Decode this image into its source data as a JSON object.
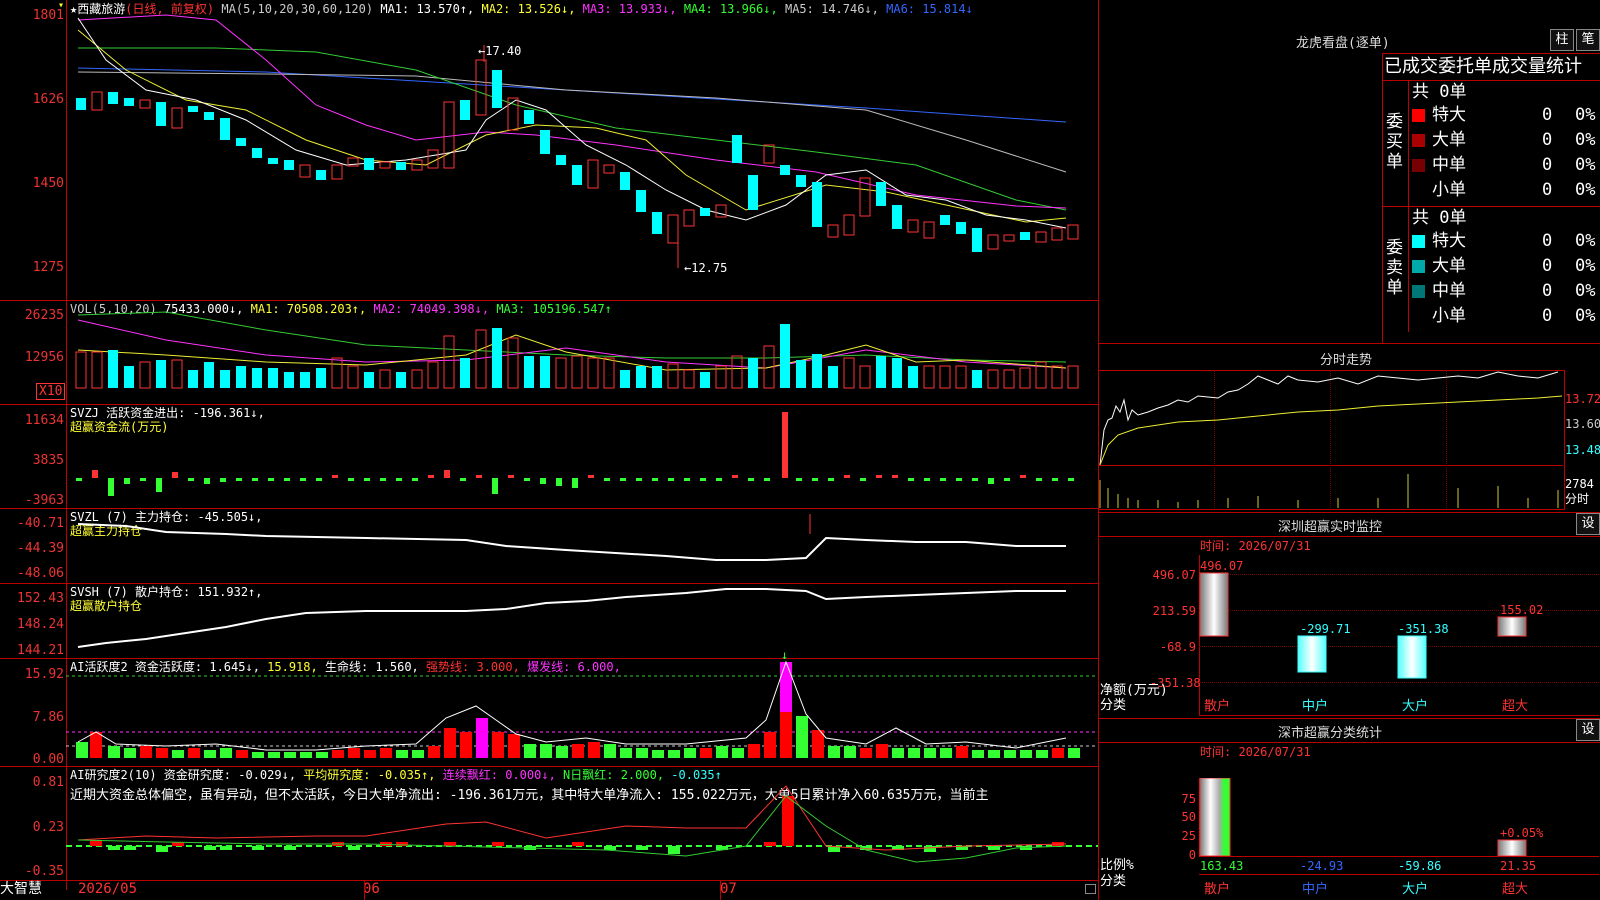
{
  "stock": {
    "name": "西藏旅游",
    "period": "(日线, 前复权)",
    "ma_prefix": "MA(5,10,20,30,60,120)",
    "ma1": "MA1: 13.570↑,",
    "ma2": "MA2: 13.526↓,",
    "ma3": "MA3: 13.933↓,",
    "ma4": "MA4: 13.966↓,",
    "ma5": "MA5: 14.746↓,",
    "ma6": "MA6: 15.814↓",
    "high_mark": "←17.40",
    "low_mark": "←12.75",
    "y_ticks": [
      "1801",
      "1626",
      "1450",
      "1275"
    ]
  },
  "vol": {
    "prefix": "VOL(5,10,20)",
    "value": "75433.000↓,",
    "ma1": "MA1: 70508.203↑,",
    "ma2": "MA2: 74049.398↓,",
    "ma3": "MA3: 105196.547↑",
    "y_ticks": [
      "26235",
      "12956"
    ],
    "unit": "X10"
  },
  "svzj": {
    "title": "SVZJ  活跃资金进出: -196.361↓,",
    "sub": "超赢资金流(万元)",
    "y_ticks": [
      "11634",
      "3835",
      "-3963"
    ]
  },
  "svzl": {
    "title": "SVZL (7) 主力持仓: -45.505↓,",
    "sub": "超赢主力持仓",
    "y_ticks": [
      "-40.71",
      "-44.39",
      "-48.06"
    ]
  },
  "svsh": {
    "title": "SVSH (7) 散户持仓: 151.932↑,",
    "sub": "超赢散户持仓",
    "y_ticks": [
      "152.43",
      "148.24",
      "144.21"
    ]
  },
  "ai2": {
    "title": "AI活跃度2 资金活跃度: 1.645↓,",
    "v2": "15.918,",
    "v3": "生命线: 1.560,",
    "v4": "强势线: 3.000,",
    "v5": "爆发线: 6.000,",
    "y_ticks": [
      "15.92",
      "7.86",
      "0.00"
    ]
  },
  "ai_research": {
    "title": "AI研究度2(10) 资金研究度: -0.029↓,",
    "avg": "平均研究度: -0.035↑,",
    "red1": "连续飘红: 0.000↓,",
    "red2": "N日飘红: 2.000,",
    "red3": "-0.035↑",
    "comment": "近期大资金总体偏空，虽有异动，但不太活跃，今日大单净流出: -196.361万元，其中特大单净流入: 155.022万元，大单5日累计净入60.635万元，当前主",
    "y_ticks": [
      "0.81",
      "0.23",
      "-0.35"
    ]
  },
  "xaxis": {
    "labels": [
      "2026/05",
      "06",
      "07"
    ],
    "logo": "大智慧"
  },
  "right": {
    "lhb_title": "龙虎看盘(逐单)",
    "btn_zhu": "柱",
    "btn_bi": "笔",
    "stats_header": "已成交委托单成交量统计",
    "buy_label": "委买单",
    "sell_label": "委卖单",
    "buy_total": "共 0单",
    "sell_total": "共 0单",
    "buy_rows": [
      {
        "label": "特大",
        "count": "0",
        "pct": "0%",
        "color": "#f00"
      },
      {
        "label": "大单",
        "count": "0",
        "pct": "0%",
        "color": "#a00"
      },
      {
        "label": "中单",
        "count": "0",
        "pct": "0%",
        "color": "#700"
      },
      {
        "label": "小单",
        "count": "0",
        "pct": "0%",
        "color": ""
      }
    ],
    "sell_rows": [
      {
        "label": "特大",
        "count": "0",
        "pct": "0%",
        "color": "#0ff"
      },
      {
        "label": "大单",
        "count": "0",
        "pct": "0%",
        "color": "#0aa"
      },
      {
        "label": "中单",
        "count": "0",
        "pct": "0%",
        "color": "#077"
      },
      {
        "label": "小单",
        "count": "0",
        "pct": "0%",
        "color": ""
      }
    ],
    "intraday_title": "分时走势",
    "intraday_prices": [
      "13.72",
      "13.60",
      "13.48"
    ],
    "intraday_vol": "2784",
    "intraday_label": "分时",
    "sz_monitor_title": "深圳超赢实时监控",
    "sz_monitor_btn": "设",
    "sz_time": "时间: 2026/07/31",
    "sz_y": [
      "496.07",
      "213.59",
      "-68.9",
      "-351.38"
    ],
    "sz_vals": [
      "496.07",
      "-299.71",
      "-351.38",
      "155.02"
    ],
    "sz_ylabel1": "净额(万元)",
    "sz_ylabel2": "分类",
    "cats": [
      "散户",
      "中户",
      "大户",
      "超大"
    ],
    "cls_title": "深市超赢分类统计",
    "cls_btn": "设",
    "cls_time": "时间: 2026/07/31",
    "cls_y": [
      "75",
      "50",
      "25",
      "0"
    ],
    "cls_vals": [
      "163.43",
      "-24.93",
      "-59.86",
      "21.35"
    ],
    "cls_note": "+0.05%",
    "cls_ylabel1": "比例%",
    "cls_ylabel2": "分类"
  }
}
